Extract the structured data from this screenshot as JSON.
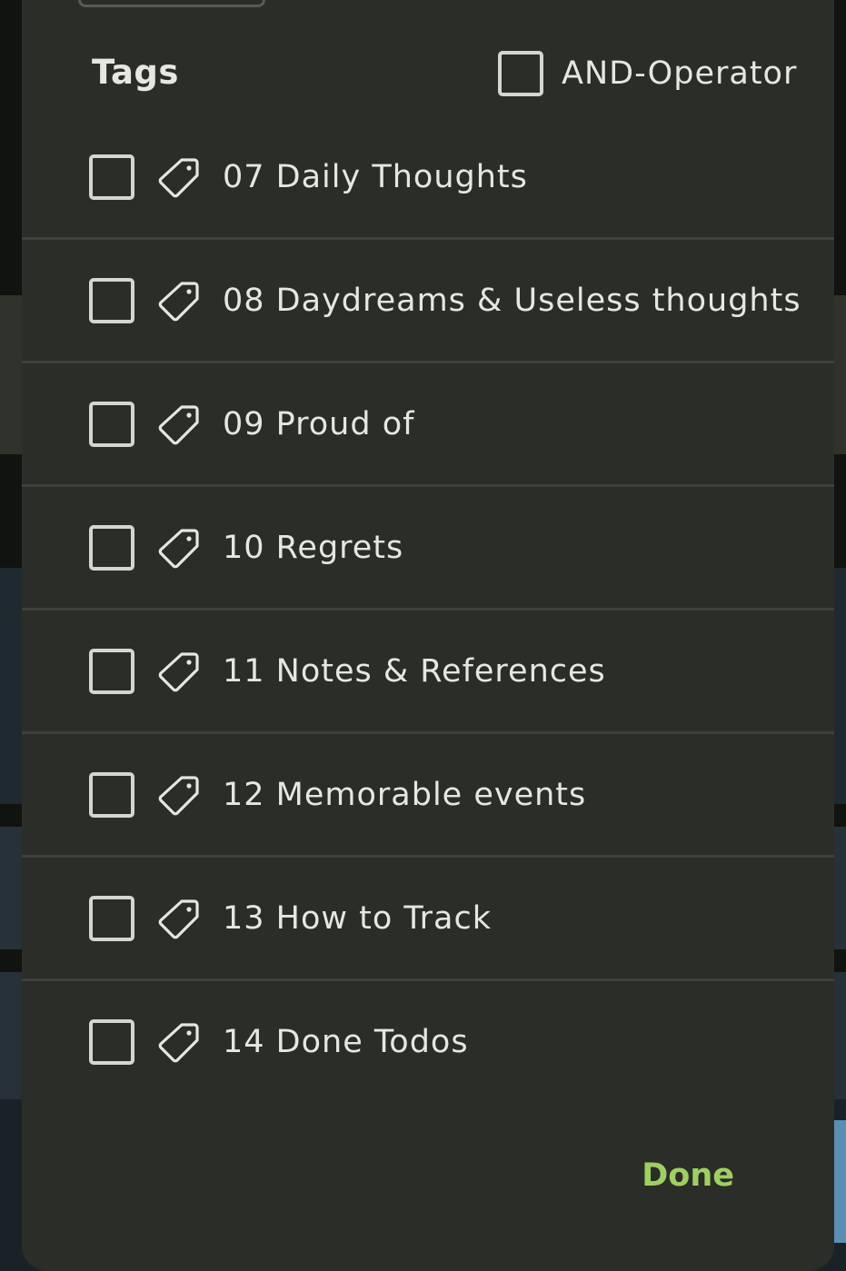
{
  "dialog": {
    "title": "Tags",
    "and_operator": {
      "label": "AND-Operator",
      "checked": false
    },
    "tags": [
      {
        "label": "07 Daily Thoughts",
        "checked": false
      },
      {
        "label": "08 Daydreams & Useless thoughts",
        "checked": false
      },
      {
        "label": "09 Proud of",
        "checked": false
      },
      {
        "label": "10 Regrets",
        "checked": false
      },
      {
        "label": "11 Notes & References",
        "checked": false
      },
      {
        "label": "12 Memorable events",
        "checked": false
      },
      {
        "label": "13 How to Track",
        "checked": false
      },
      {
        "label": "14 Done Todos",
        "checked": false
      }
    ],
    "done_label": "Done"
  },
  "colors": {
    "dialog_bg": "#2a2d28",
    "text": "#e6e7e2",
    "accent": "#9fcf62",
    "divider": "#3f423c",
    "checkbox_border": "#d4d6cf"
  },
  "icons": {
    "tag": "tag-icon",
    "checkbox": "checkbox-unchecked-icon"
  }
}
